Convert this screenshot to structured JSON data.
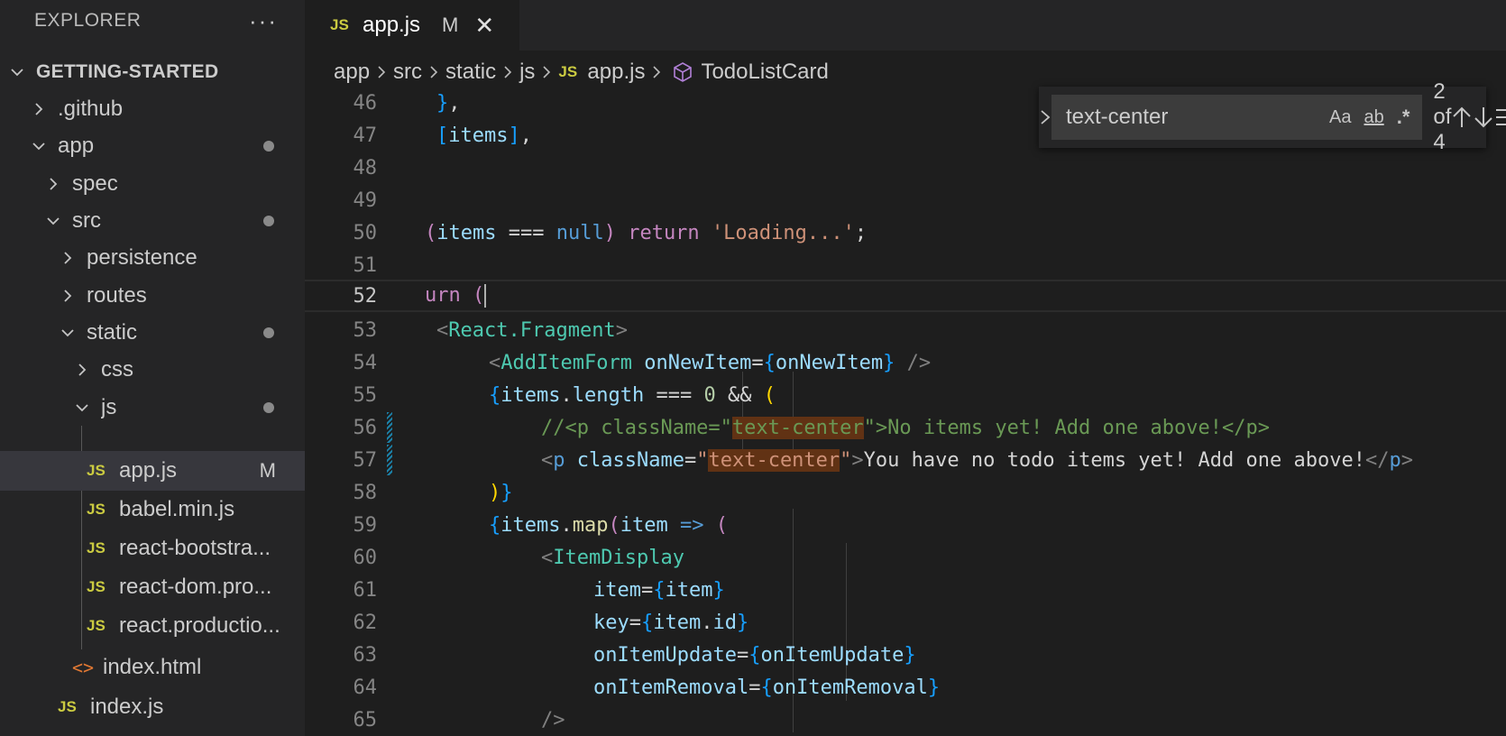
{
  "sidebar": {
    "title": "EXPLORER",
    "more": "···",
    "root": "GETTING-STARTED",
    "items": [
      {
        "label": ".github"
      },
      {
        "label": "app"
      },
      {
        "label": "spec"
      },
      {
        "label": "src"
      },
      {
        "label": "persistence"
      },
      {
        "label": "routes"
      },
      {
        "label": "static"
      },
      {
        "label": "css"
      },
      {
        "label": "js"
      },
      {
        "label": "app.js",
        "badge": "M"
      },
      {
        "label": "babel.min.js"
      },
      {
        "label": "react-bootstra..."
      },
      {
        "label": "react-dom.pro..."
      },
      {
        "label": "react.productio..."
      },
      {
        "label": "index.html"
      },
      {
        "label": "index.js"
      }
    ],
    "js_icon_text": "JS",
    "html_icon_text": "<>"
  },
  "tab": {
    "label": "app.js",
    "modified": "M",
    "close": "✕",
    "icon": "JS"
  },
  "breadcrumb": {
    "parts": [
      "app",
      "src",
      "static",
      "js"
    ],
    "file": "app.js",
    "symbol": "TodoListCard"
  },
  "find": {
    "query": "text-center",
    "match_case": "Aa",
    "whole_word": "ab",
    "regex": ".*",
    "count": "2 of 4"
  },
  "editor": {
    "line_numbers": [
      "46",
      "47",
      "48",
      "49",
      "50",
      "51",
      "52",
      "53",
      "54",
      "55",
      "56",
      "57",
      "58",
      "59",
      "60",
      "61",
      "62",
      "63",
      "64",
      "65"
    ],
    "current_line": "52"
  },
  "colors": {
    "accent": "#007acc",
    "highlight": "#613214"
  }
}
